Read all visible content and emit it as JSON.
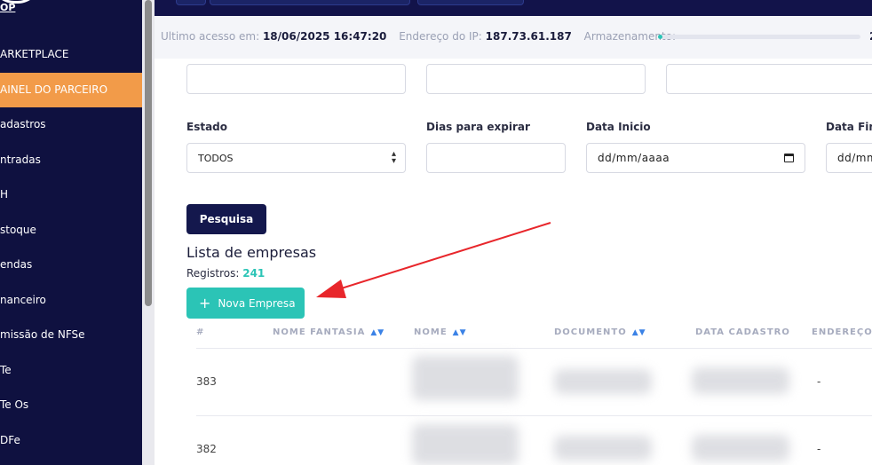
{
  "sidebar": {
    "logo_text": "OP",
    "items": [
      {
        "label": "ARKETPLACE",
        "active": false
      },
      {
        "label": "AINEL DO PARCEIRO",
        "active": true
      },
      {
        "label": "adastros",
        "active": false
      },
      {
        "label": "ntradas",
        "active": false
      },
      {
        "label": "H",
        "active": false
      },
      {
        "label": "stoque",
        "active": false
      },
      {
        "label": "endas",
        "active": false
      },
      {
        "label": "nanceiro",
        "active": false
      },
      {
        "label": "missão de NFSe",
        "active": false
      },
      {
        "label": "Te",
        "active": false
      },
      {
        "label": "Te Os",
        "active": false
      },
      {
        "label": "DFe",
        "active": false
      }
    ]
  },
  "status": {
    "last_access_label": "Ultimo acesso em:",
    "last_access_value": "18/06/2025 16:47:20",
    "ip_label": "Endereço do IP:",
    "ip_value": "187.73.61.187",
    "storage_label": "Armazenamento:",
    "storage_fraction": 0.01,
    "storage_value": "2"
  },
  "filters": {
    "estado_label": "Estado",
    "estado_value": "TODOS",
    "dias_label": "Dias para expirar",
    "dias_value": "",
    "data_inicio_label": "Data Inicio",
    "data_inicio_placeholder": "dd/mm/aaaa",
    "data_fim_label": "Data Fina",
    "data_fim_placeholder": "dd/mm"
  },
  "actions": {
    "search_label": "Pesquisa",
    "new_company_label": "Nova Empresa"
  },
  "list": {
    "title": "Lista de empresas",
    "registros_label": "Registros:",
    "registros_count": "241",
    "columns": [
      "#",
      "NOME FANTASIA",
      "NOME",
      "DOCUMENTO",
      "DATA CADASTRO",
      "ENDEREÇO"
    ],
    "rows": [
      {
        "id": "383",
        "endereco": "-"
      },
      {
        "id": "382",
        "endereco": "-"
      }
    ]
  },
  "colors": {
    "sidebar_bg": "#0f1140",
    "active_item": "#f29b49",
    "accent_teal": "#2bc4b6",
    "primary_dark": "#14184d",
    "annotation_arrow": "#e8262b"
  }
}
